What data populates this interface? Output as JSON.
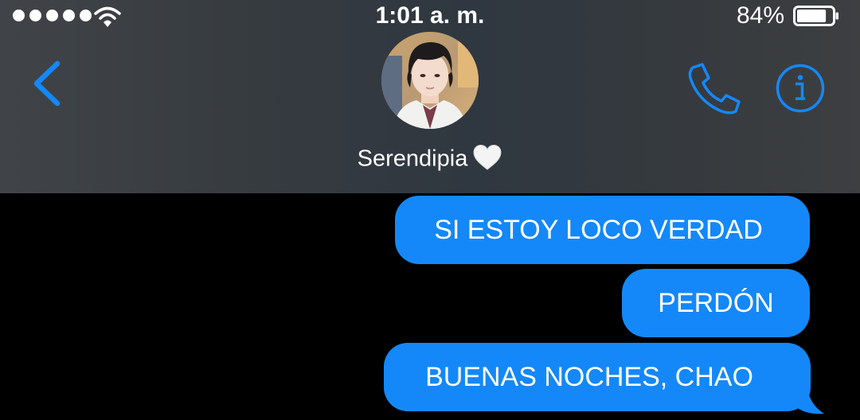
{
  "status_bar": {
    "time": "1:01 a. m.",
    "battery_percent": "84%",
    "battery_level": 0.84,
    "signal_bars": 5,
    "wifi_icon": "wifi-icon"
  },
  "nav": {
    "back_icon": "chevron-left-icon",
    "contact_name": "Serendipia",
    "contact_emoji": "white-heart-icon",
    "phone_icon": "phone-icon",
    "info_icon": "info-icon"
  },
  "messages": [
    {
      "text": "SI ESTOY LOCO VERDAD",
      "direction": "outgoing"
    },
    {
      "text": "PERDÓN",
      "direction": "outgoing"
    },
    {
      "text": "BUENAS NOCHES, CHAO",
      "direction": "outgoing"
    }
  ],
  "colors": {
    "accent": "#1488f8",
    "bubble_text": "#ffffff",
    "background": "#000000",
    "header": "#363b40"
  }
}
